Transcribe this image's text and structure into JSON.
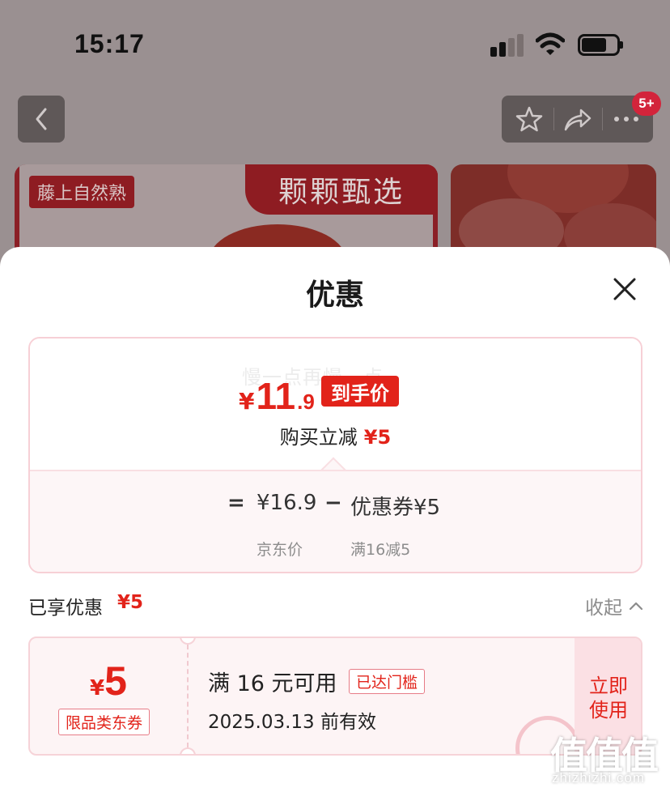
{
  "status_bar": {
    "time": "15:17"
  },
  "background": {
    "hero_tag": "藤上自然熟",
    "hero_title": "颗颗甄选",
    "cart_badge": "5+"
  },
  "sheet": {
    "title": "优惠",
    "price_card": {
      "watermark": "慢一点再慢一点",
      "final_currency": "¥",
      "final_int": "11",
      "final_dec": ".9",
      "final_tag": "到手价",
      "instant_label": "购买立减",
      "instant_amount": "¥5",
      "calc_equals": "=",
      "jd_price": "¥16.9",
      "minus": "−",
      "coupon_part": "优惠券¥5",
      "jd_price_label": "京东价",
      "coupon_rule": "满16减5"
    },
    "enjoyed": {
      "label": "已享优惠",
      "amount": "¥5",
      "collapse_label": "收起"
    },
    "coupon": {
      "currency": "¥",
      "amount": "5",
      "type": "限品类东券",
      "condition": "满 16 元可用",
      "threshold_tag": "已达门槛",
      "expiry": "2025.03.13 前有效",
      "use_label_1": "立即",
      "use_label_2": "使用"
    }
  },
  "watermark_logo": {
    "glyphs": "值值值",
    "domain": "zhizhizhi.com"
  },
  "colors": {
    "accent": "#e2231a",
    "accent_soft": "#fdf4f5",
    "border_pink": "#f6d3d8"
  },
  "icons": [
    "back-chevron-icon",
    "star-icon",
    "share-icon",
    "more-icon",
    "close-icon",
    "chevron-up-icon"
  ]
}
